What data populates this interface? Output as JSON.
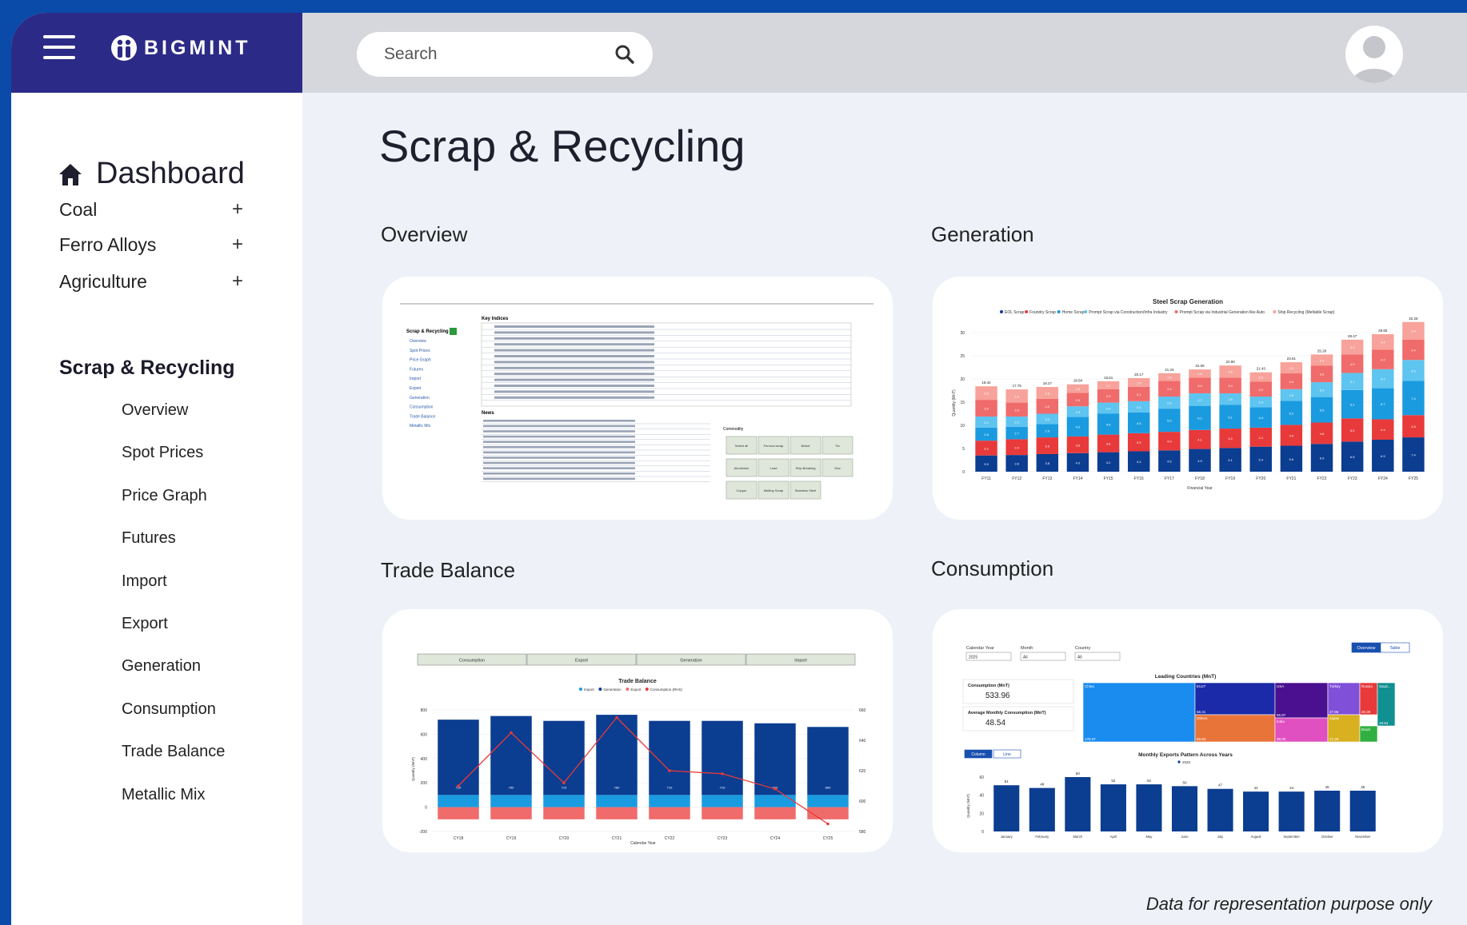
{
  "header": {
    "brand": "BIGMINT",
    "search_placeholder": "Search"
  },
  "sidebar": {
    "dashboard_label": "Dashboard",
    "groups": [
      {
        "label": "Coal",
        "expand": "+"
      },
      {
        "label": "Ferro Alloys",
        "expand": "+"
      },
      {
        "label": "Agriculture",
        "expand": "+"
      }
    ],
    "section_label": "Scrap & Recycling",
    "sub_items": [
      "Overview",
      "Spot Prices",
      "Price Graph",
      "Futures",
      "Import",
      "Export",
      "Generation",
      "Consumption",
      "Trade Balance",
      "Metallic Mix"
    ]
  },
  "main": {
    "page_title": "Scrap & Recycling",
    "cards": {
      "overview": {
        "title": "Overview",
        "panel_title": "Scrap & Recycling",
        "key_indices": "Key Indices",
        "news": "News",
        "commodity": "Commodity",
        "nav": [
          "Overview",
          "Spot Prices",
          "Price Graph",
          "Futures",
          "Import",
          "Export",
          "Generation",
          "Consumption",
          "Trade Balance",
          "Metallic Mix"
        ],
        "commodity_buttons": [
          "Select all",
          "Ferrous scrap",
          "Nickel",
          "Tin",
          "Aluminium",
          "Lead",
          "Ship Breaking",
          "Zinc",
          "Copper",
          "Melting Scrap",
          "Stainless Steel"
        ]
      },
      "generation": {
        "title": "Generation"
      },
      "trade_balance": {
        "title": "Trade Balance",
        "tabs": [
          "Consumption",
          "Export",
          "Generation",
          "Import"
        ]
      },
      "consumption": {
        "title": "Consumption",
        "filters": [
          {
            "label": "Calendar Year",
            "value": "2025"
          },
          {
            "label": "Month",
            "value": "All"
          },
          {
            "label": "Country",
            "value": "All"
          }
        ],
        "view_buttons": [
          "Overview",
          "Table"
        ],
        "kpis": [
          {
            "label": "Consumption (MnT)",
            "value": "533.96"
          },
          {
            "label": "Average Monthly Consumption (MnT)",
            "value": "48.54"
          }
        ],
        "chart_toggle": [
          "Column",
          "Line"
        ]
      }
    }
  },
  "chart_data": [
    {
      "type": "bar",
      "title": "Steel Scrap Generation",
      "xlabel": "Financial Year",
      "ylabel": "Quantity (MnT)",
      "ylim": [
        0,
        30
      ],
      "categories": [
        "FY11",
        "FY12",
        "FY13",
        "FY14",
        "FY15",
        "FY16",
        "FY17",
        "FY18",
        "FY19",
        "FY20",
        "FY21",
        "FY22",
        "FY23",
        "FY24",
        "FY25"
      ],
      "totals": [
        18.42,
        17.75,
        18.27,
        18.84,
        19.51,
        20.17,
        21.24,
        22.05,
        22.9,
        21.43,
        23.61,
        25.28,
        28.47,
        29.65,
        32.28
      ],
      "series": [
        {
          "name": "EOL Scrap",
          "color": "#0b3d91",
          "values": [
            3.5,
            3.6,
            3.8,
            4.0,
            4.2,
            4.4,
            4.6,
            4.9,
            5.1,
            5.4,
            5.6,
            6.0,
            6.5,
            6.9,
            7.4
          ]
        },
        {
          "name": "Foundry Scrap",
          "color": "#e83a3a",
          "values": [
            3.2,
            3.4,
            3.6,
            3.6,
            3.8,
            3.9,
            4.0,
            4.1,
            4.2,
            4.1,
            4.5,
            4.6,
            5.0,
            4.4,
            4.8
          ]
        },
        {
          "name": "Home Scrap",
          "color": "#1a9be0",
          "values": [
            2.8,
            2.7,
            2.9,
            4.2,
            4.5,
            4.5,
            5.0,
            5.2,
            5.1,
            4.4,
            5.2,
            5.5,
            6.1,
            6.7,
            7.4
          ]
        },
        {
          "name": "Prompt Scrap via Construction/Infra Industry",
          "color": "#5ec4f0",
          "values": [
            2.4,
            2.2,
            2.2,
            2.3,
            2.4,
            2.4,
            2.6,
            2.7,
            2.5,
            2.3,
            2.5,
            3.2,
            3.7,
            4.1,
            4.5
          ]
        },
        {
          "name": "Prompt Scrap via Industrial Generation like Auto",
          "color": "#f06b6b",
          "values": [
            3.6,
            3.0,
            3.2,
            2.9,
            2.9,
            3.1,
            3.4,
            3.4,
            3.4,
            3.2,
            3.4,
            3.6,
            4.0,
            4.2,
            4.4
          ]
        },
        {
          "name": "Ship Recycling (Meltable Scrap)",
          "color": "#f7a29a",
          "values": [
            2.92,
            2.85,
            2.57,
            1.84,
            1.71,
            1.87,
            1.64,
            1.75,
            2.6,
            2.03,
            2.41,
            2.38,
            3.17,
            3.35,
            3.78
          ]
        }
      ]
    },
    {
      "type": "bar",
      "title": "Trade Balance",
      "xlabel": "Calendar Year",
      "ylabel": "Quantity (MnT)",
      "ylim": [
        -200,
        800
      ],
      "categories": [
        "CY18",
        "CY19",
        "CY20",
        "CY21",
        "CY22",
        "CY23",
        "CY24",
        "CY25"
      ],
      "series": [
        {
          "name": "Import",
          "color": "#1a9be0",
          "values": [
            -30,
            -30,
            -30,
            -30,
            -30,
            -30,
            -30,
            -30
          ]
        },
        {
          "name": "Generation",
          "color": "#0b3d91",
          "values": [
            720,
            750,
            710,
            760,
            710,
            710,
            690,
            660
          ]
        },
        {
          "name": "Export",
          "color": "#f06b6b",
          "values": [
            -100,
            -100,
            -100,
            -100,
            -100,
            -100,
            -100,
            -100
          ]
        },
        {
          "name": "Consumption (RHS)",
          "color": "#e83a3a",
          "values": [
            610,
            645,
            612,
            655,
            620,
            618,
            608,
            585
          ]
        }
      ],
      "y2lim": [
        580,
        660
      ]
    },
    {
      "type": "bar",
      "title": "Monthly Exports Pattern Across Years",
      "ylabel": "Quantity (MnT)",
      "ylim": [
        0,
        60
      ],
      "legend": "2025",
      "categories": [
        "January",
        "February",
        "March",
        "April",
        "May",
        "June",
        "July",
        "August",
        "September",
        "October",
        "November"
      ],
      "values": [
        51,
        48,
        60,
        52,
        52,
        50,
        47,
        44,
        44,
        45,
        45
      ]
    },
    {
      "type": "heatmap",
      "title": "Leading Countries (MnT)",
      "cells": [
        {
          "label": "China",
          "value": 178.07,
          "color": "#1a8cf0"
        },
        {
          "label": "EU27",
          "value": 68.31,
          "color": "#1a2aa8"
        },
        {
          "label": "Others",
          "value": 66.53,
          "color": "#e8743a"
        },
        {
          "label": "USA",
          "value": 56.97,
          "color": "#4a1090"
        },
        {
          "label": "India",
          "value": 35.0,
          "color": "#e050c0"
        },
        {
          "label": "Turkey",
          "value": 27.96,
          "color": "#8050d8"
        },
        {
          "label": "Japan",
          "value": 27.29,
          "color": "#d8b020"
        },
        {
          "label": "Russia",
          "value": 20.39,
          "color": "#e83a3a"
        },
        {
          "label": "Saud...",
          "value": 19.54,
          "color": "#109090"
        },
        {
          "label": "Brazil",
          "value": null,
          "color": "#30b040"
        }
      ]
    }
  ]
}
